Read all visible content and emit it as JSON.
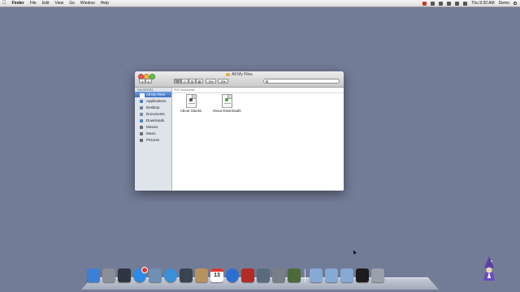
{
  "menubar": {
    "apple": "",
    "app_name": "Finder",
    "menus": [
      "File",
      "Edit",
      "View",
      "Go",
      "Window",
      "Help"
    ],
    "clock": "Thu 9:20 AM",
    "user": "Demo"
  },
  "window": {
    "title": "All My Files",
    "toolbar": {
      "back": "◂",
      "forward": "▸",
      "views": [
        "⊞",
        "≡",
        "▥",
        "▦"
      ],
      "action": "⚙▾",
      "arrange": "☰▾"
    },
    "search": {
      "placeholder": ""
    },
    "sidebar": {
      "heading": "FAVORITES",
      "items": [
        {
          "label": "All My Files",
          "icon": "all-files-icon",
          "color": "#ffffff",
          "selected": true
        },
        {
          "label": "Applications",
          "icon": "applications-icon",
          "color": "#4d7bc4"
        },
        {
          "label": "Desktop",
          "icon": "desktop-icon",
          "color": "#6f7f96"
        },
        {
          "label": "Documents",
          "icon": "documents-icon",
          "color": "#7a8aa0"
        },
        {
          "label": "Downloads",
          "icon": "downloads-icon",
          "color": "#4e84c8"
        },
        {
          "label": "Movies",
          "icon": "movies-icon",
          "color": "#6a6a6a"
        },
        {
          "label": "Music",
          "icon": "music-icon",
          "color": "#6a6a6a"
        },
        {
          "label": "Pictures",
          "icon": "pictures-icon",
          "color": "#6a6a6a"
        }
      ]
    },
    "content": {
      "group": "PDF Documents",
      "files": [
        {
          "name": "About Stacks",
          "icon": "pdf-document-icon",
          "accent": "#555555"
        },
        {
          "name": "About Downloads",
          "icon": "pdf-document-icon",
          "accent": "#3ea23a"
        }
      ]
    }
  },
  "dock": {
    "apps": [
      {
        "name": "finder-icon",
        "color": "#3b7fd6"
      },
      {
        "name": "launchpad-icon",
        "color": "#8a8f99"
      },
      {
        "name": "mission-control-icon",
        "color": "#2f3640"
      },
      {
        "name": "app-store-icon",
        "color": "#2d8ae6",
        "badge": true
      },
      {
        "name": "mail-icon",
        "color": "#6f8fb4"
      },
      {
        "name": "safari-icon",
        "color": "#3a8fd9"
      },
      {
        "name": "facetime-icon",
        "color": "#3a4450"
      },
      {
        "name": "contacts-icon",
        "color": "#b8935c"
      },
      {
        "name": "calendar-icon",
        "color": "#ffffff",
        "date": "13"
      },
      {
        "name": "itunes-icon",
        "color": "#2d6fd0"
      },
      {
        "name": "photo-booth-icon",
        "color": "#b42a24"
      },
      {
        "name": "iphoto-icon",
        "color": "#5a6b7d"
      },
      {
        "name": "system-preferences-icon",
        "color": "#7a7f87"
      },
      {
        "name": "utility-icon",
        "color": "#4c6a3a"
      }
    ],
    "stacks": [
      {
        "name": "applications-stack-icon",
        "color": "#86a9d6"
      },
      {
        "name": "documents-stack-icon",
        "color": "#86a9d6"
      },
      {
        "name": "downloads-stack-icon",
        "color": "#86a9d6"
      },
      {
        "name": "terminal-icon",
        "color": "#1c1c1c"
      },
      {
        "name": "trash-icon",
        "color": "#9aa1ab"
      }
    ]
  }
}
